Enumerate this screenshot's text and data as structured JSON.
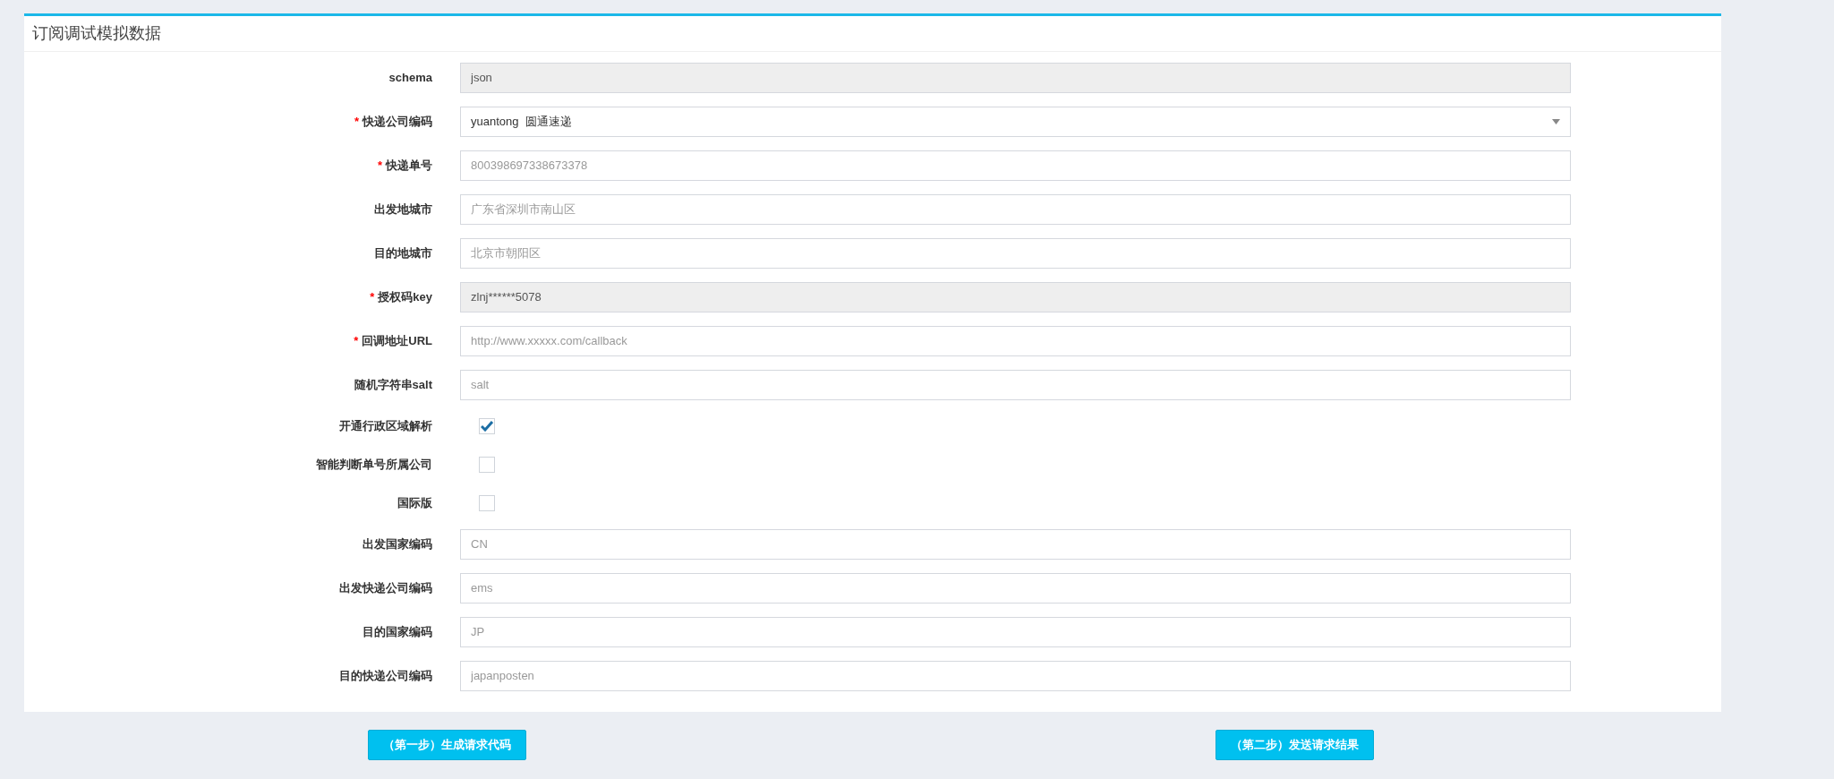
{
  "panel": {
    "title": "订阅调试模拟数据"
  },
  "fields": [
    {
      "kind": "text",
      "label": "schema",
      "value": "json",
      "disabled": true
    },
    {
      "kind": "select",
      "label": "快递公司编码",
      "required_mark": "*",
      "value": "yuantong  圆通速递",
      "disabled": false
    },
    {
      "kind": "text",
      "label": "快递单号",
      "required_mark": "*",
      "placeholder": "800398697338673378",
      "disabled": false
    },
    {
      "kind": "text",
      "label": "出发地城市",
      "placeholder": "广东省深圳市南山区",
      "disabled": false
    },
    {
      "kind": "text",
      "label": "目的地城市",
      "placeholder": "北京市朝阳区",
      "disabled": false
    },
    {
      "kind": "text",
      "label": "授权码key",
      "required_mark": "*",
      "value": "zlnj******5078",
      "disabled": true
    },
    {
      "kind": "text",
      "label": "回调地址URL",
      "required_mark": "*",
      "placeholder": "http://www.xxxxx.com/callback",
      "disabled": false
    },
    {
      "kind": "text",
      "label": "随机字符串salt",
      "placeholder": "salt",
      "disabled": false
    },
    {
      "kind": "checkbox",
      "label": "开通行政区域解析",
      "checked": true
    },
    {
      "kind": "checkbox",
      "label": "智能判断单号所属公司",
      "checked": false
    },
    {
      "kind": "checkbox",
      "label": "国际版",
      "checked": false
    },
    {
      "kind": "text",
      "label": "出发国家编码",
      "placeholder": "CN",
      "disabled": false
    },
    {
      "kind": "text",
      "label": "出发快递公司编码",
      "placeholder": "ems",
      "disabled": false
    },
    {
      "kind": "text",
      "label": "目的国家编码",
      "placeholder": "JP",
      "disabled": false
    },
    {
      "kind": "text",
      "label": "目的快递公司编码",
      "placeholder": "japanposten",
      "disabled": false
    }
  ],
  "buttons": [
    "（第一步）生成请求代码",
    "（第二步）发送请求结果"
  ]
}
